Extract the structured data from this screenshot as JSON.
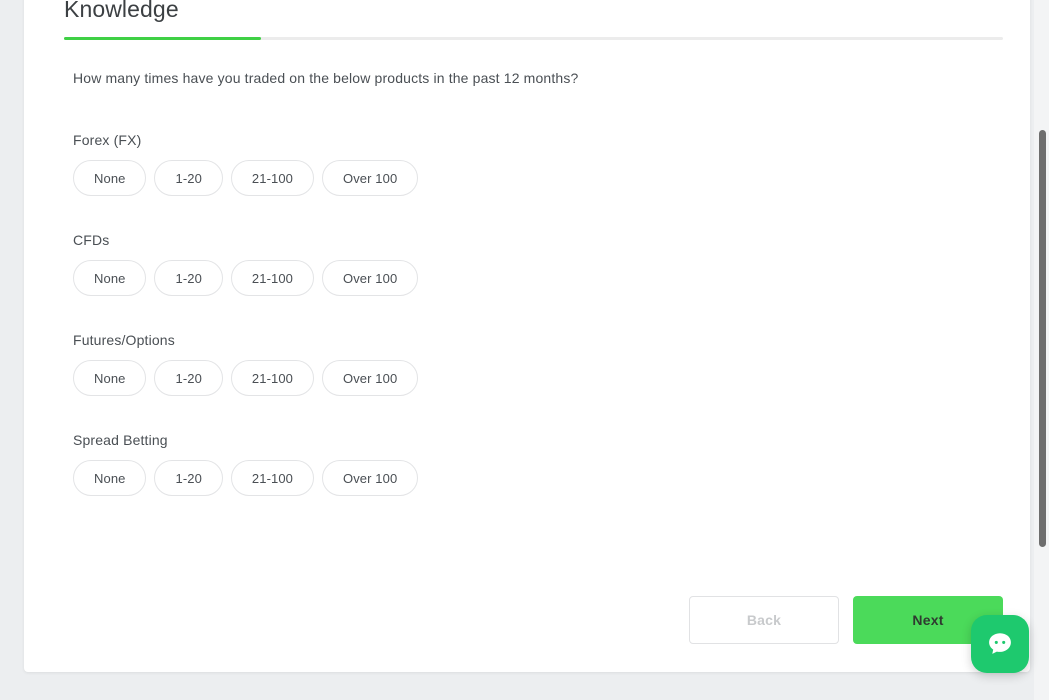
{
  "section": {
    "title": "Knowledge",
    "progress_percent": 21
  },
  "question": "How many times have you traded on the below products in the past 12 months?",
  "groups": [
    {
      "label": "Forex (FX)",
      "options": [
        "None",
        "1-20",
        "21-100",
        "Over 100"
      ]
    },
    {
      "label": "CFDs",
      "options": [
        "None",
        "1-20",
        "21-100",
        "Over 100"
      ]
    },
    {
      "label": "Futures/Options",
      "options": [
        "None",
        "1-20",
        "21-100",
        "Over 100"
      ]
    },
    {
      "label": "Spread Betting",
      "options": [
        "None",
        "1-20",
        "21-100",
        "Over 100"
      ]
    }
  ],
  "footer": {
    "back_label": "Back",
    "next_label": "Next"
  },
  "chat": {
    "icon": "chat-bubble-icon"
  },
  "colors": {
    "progress_fill": "#3fd045",
    "next_button": "#4bda5a",
    "chat_button": "#1ec96e",
    "page_background": "#eceef0",
    "card_background": "#ffffff"
  }
}
